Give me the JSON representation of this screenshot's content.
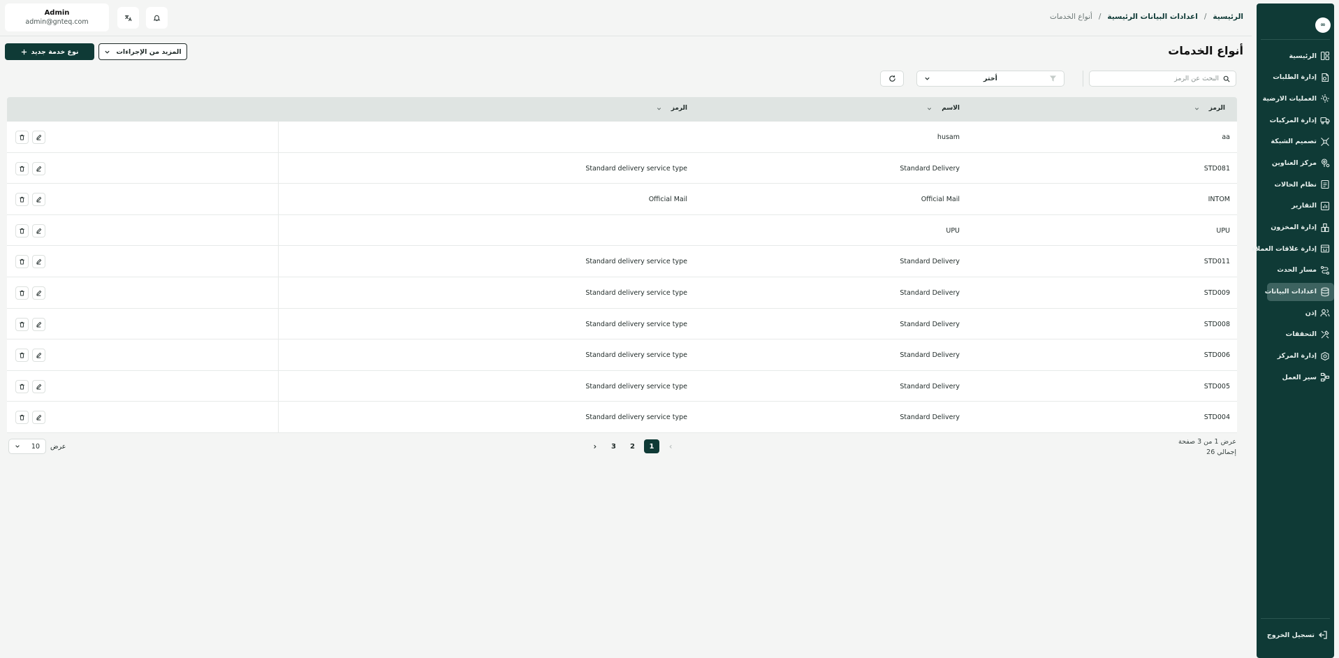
{
  "sidebar": {
    "logo": "∞",
    "items": [
      {
        "label": "الرئيسية",
        "icon": "dashboard-icon"
      },
      {
        "label": "إدارة الطلبات",
        "icon": "orders-icon"
      },
      {
        "label": "العمليات الارضية",
        "icon": "ground-ops-icon"
      },
      {
        "label": "إدارة المركبات",
        "icon": "truck-icon"
      },
      {
        "label": "تصميم الشبكة",
        "icon": "network-icon"
      },
      {
        "label": "مركز العناوين",
        "icon": "location-icon"
      },
      {
        "label": "نظام الحالات",
        "icon": "status-icon"
      },
      {
        "label": "التقارير",
        "icon": "reports-icon"
      },
      {
        "label": "إدارة المخزون",
        "icon": "inventory-icon"
      },
      {
        "label": "إدارة علاقات العملاء",
        "icon": "crm-icon"
      },
      {
        "label": "مسار الحدث",
        "icon": "route-icon"
      },
      {
        "label": "اعدادات البيانات",
        "icon": "database-icon"
      },
      {
        "label": "إذن",
        "icon": "users-icon"
      },
      {
        "label": "التحققات",
        "icon": "tools-icon"
      },
      {
        "label": "إدارة المركز",
        "icon": "center-icon"
      },
      {
        "label": "سير العمل",
        "icon": "workflow-icon"
      }
    ],
    "active_index": 11,
    "logout_label": "تسجيل الخروج"
  },
  "header": {
    "breadcrumb": [
      "الرئيسية",
      "اعدادات البيانات الرئيسية",
      "أنواع الخدمات"
    ],
    "user_name": "Admin",
    "user_email": "admin@gnteq.com"
  },
  "page": {
    "title": "أنواع الخدمات",
    "new_button": "نوع خدمة جديد",
    "more_button": "المزيد من الإجراءات",
    "search_placeholder": "البحث عن الرمز",
    "filter_placeholder": "أختر"
  },
  "table": {
    "columns": [
      "الرمز",
      "الاسم",
      "الرمز"
    ],
    "rows": [
      {
        "code": "aa",
        "name": "husam",
        "desc": ""
      },
      {
        "code": "STD081",
        "name": "Standard Delivery",
        "desc": "Standard delivery service type"
      },
      {
        "code": "INTOM",
        "name": "Official Mail",
        "desc": "Official Mail"
      },
      {
        "code": "UPU",
        "name": "UPU",
        "desc": ""
      },
      {
        "code": "STD011",
        "name": "Standard Delivery",
        "desc": "Standard delivery service type"
      },
      {
        "code": "STD009",
        "name": "Standard Delivery",
        "desc": "Standard delivery service type"
      },
      {
        "code": "STD008",
        "name": "Standard Delivery",
        "desc": "Standard delivery service type"
      },
      {
        "code": "STD006",
        "name": "Standard Delivery",
        "desc": "Standard delivery service type"
      },
      {
        "code": "STD005",
        "name": "Standard Delivery",
        "desc": "Standard delivery service type"
      },
      {
        "code": "STD004",
        "name": "Standard Delivery",
        "desc": "Standard delivery service type"
      }
    ]
  },
  "pagination": {
    "info_line1": "عرض 1 من 3 صفحة",
    "info_line2": "إجمالي 26",
    "pages": [
      "1",
      "2",
      "3"
    ],
    "current": "1",
    "per_page_label": "عرض",
    "per_page_value": "10"
  },
  "colors": {
    "primary": "#0f3a36",
    "background": "#f4f5f4",
    "header_row": "#dfe4e2"
  }
}
